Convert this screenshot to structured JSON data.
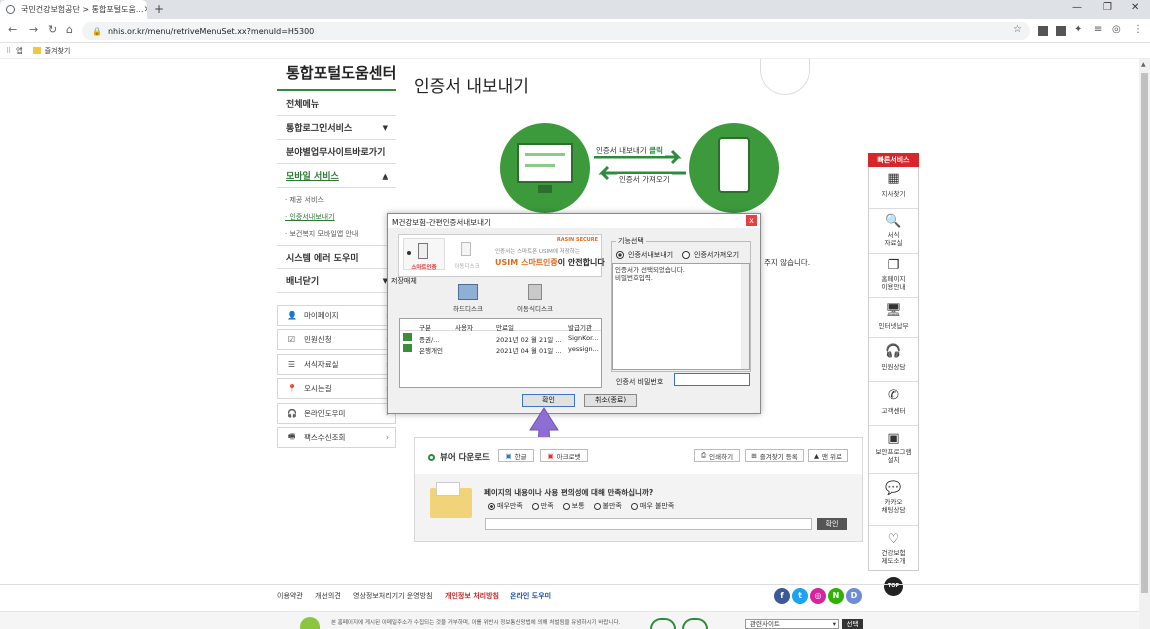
{
  "browser": {
    "tab_title": "국민건강보험공단 > 통합포털도움...",
    "url": "nhis.or.kr/menu/retriveMenuSet.xx?menuId=H5300",
    "bookmarks": [
      {
        "label": "앱"
      },
      {
        "label": "즐겨찾기"
      }
    ]
  },
  "sidebar": {
    "title": "통합포털도움센터",
    "items": [
      {
        "label": "전체메뉴",
        "arrow": ""
      },
      {
        "label": "통합로그인서비스",
        "arrow": "▼"
      },
      {
        "label": "분야별업무사이트바로가기",
        "arrow": ""
      },
      {
        "label": "모바일 서비스",
        "arrow": "▲"
      }
    ],
    "subitems": [
      "제공 서비스",
      "인증서내보내기",
      "보건복지 모바일앱 안내"
    ],
    "items2": [
      {
        "label": "시스템 에러 도우미",
        "arrow": ""
      },
      {
        "label": "배너닫기",
        "arrow": "▼"
      }
    ],
    "buttons": [
      {
        "label": "마이페이지",
        "icon": "person-icon",
        "glyph": "👤"
      },
      {
        "label": "민원신청",
        "icon": "document-check-icon",
        "glyph": "☑"
      },
      {
        "label": "서식자료실",
        "icon": "list-icon",
        "glyph": "☰"
      },
      {
        "label": "오시는길",
        "icon": "location-pin-icon",
        "glyph": "📍"
      },
      {
        "label": "온라인도우미",
        "icon": "headset-icon",
        "glyph": "🎧"
      },
      {
        "label": "팩스수신조회",
        "icon": "fax-icon",
        "glyph": "🖷"
      }
    ]
  },
  "main": {
    "title": "인증서 내보내기",
    "diagram": {
      "export_label": "인증서 내보내기",
      "export_click": "클릭",
      "import_label": "인증서 가져오기"
    },
    "trailing_text": "주지 않습니다."
  },
  "dialog": {
    "title": "M건강보험-간편인증서내보내기",
    "close": "x",
    "banner": {
      "brand": "RASIN SECURE",
      "tab1": "스마트인증",
      "tab2": "이동디스크",
      "line1": "인증서는 스마트폰 USIM에 저장하는",
      "line2a": "USIM 스마트인증",
      "line2b": "이 안전합니다"
    },
    "storage_label": "저장매체",
    "media": [
      {
        "label": "하드디스크"
      },
      {
        "label": "이동식디스크"
      }
    ],
    "table": {
      "headers": [
        "구분",
        "사용자",
        "만료일",
        "발급기관"
      ],
      "rows": [
        {
          "type": "증권/...",
          "user": "",
          "expiry": "2021년 02 월 21일 ...",
          "issuer": "SignKor..."
        },
        {
          "type": "은행개인",
          "user": "",
          "expiry": "2021년 04 월 01일 ...",
          "issuer": "yessign..."
        }
      ]
    },
    "function_label": "기능선택",
    "radio_export": "인증서내보내기",
    "radio_import": "인증서가져오기",
    "message": "인증서가 선택되었습니다.\n비밀번호입력.",
    "password_label": "인증서 비밀번호",
    "password_value": "",
    "ok": "확인",
    "cancel": "취소(종료)"
  },
  "viewer": {
    "title": "뷰어 다운로드",
    "hangul": "한글",
    "acrobat": "아크로뱃",
    "print": "인쇄하기",
    "favorite": "즐겨찾기 등록",
    "top": "맨 위로",
    "survey_question": "페이지의 내용이나 사용 편의성에 대해 만족하십니까?",
    "options": [
      "매우만족",
      "만족",
      "보통",
      "불만족",
      "매우 불만족"
    ],
    "submit": "확인"
  },
  "quick_menu": {
    "title": "빠른서비스",
    "items": [
      {
        "label": "지사찾기",
        "icon": "building-icon",
        "glyph": "▦"
      },
      {
        "label": "서식\n자료실",
        "icon": "document-search-icon",
        "glyph": "🔍"
      },
      {
        "label": "홈페이지\n이용안내",
        "icon": "copy-doc-icon",
        "glyph": "❐"
      },
      {
        "label": "인터넷납부",
        "icon": "monitor-pay-icon",
        "glyph": "🖥"
      },
      {
        "label": "민원상담",
        "icon": "headset-icon",
        "glyph": "🎧"
      },
      {
        "label": "고객센터",
        "icon": "phone-icon",
        "glyph": "✆"
      },
      {
        "label": "보안프로그램\n설치",
        "icon": "security-program-icon",
        "glyph": "▣"
      },
      {
        "label": "카카오\n채팅상담",
        "icon": "kakao-talk-icon",
        "glyph": "💬"
      },
      {
        "label": "건강보험\n제도소개",
        "icon": "heart-pulse-icon",
        "glyph": "♡"
      }
    ],
    "top": "TOP"
  },
  "footer": {
    "links": [
      "이용약관",
      "개선의견",
      "영상정보처리기기 운영방침",
      "개인정보 처리방침",
      "온라인 도우미"
    ],
    "notice": "본 홈페이지에 게시된 이메일주소가 수집되는 것을 거부하며, 이를 위반시 정보통신망법에 의해 처벌됨을 유념하시기 바랍니다.",
    "related_site": "관련사이트",
    "select_btn": "선택"
  },
  "colors": {
    "green": "#2c8b3c",
    "red": "#d9262a",
    "arrow": "#8e6fd1"
  }
}
